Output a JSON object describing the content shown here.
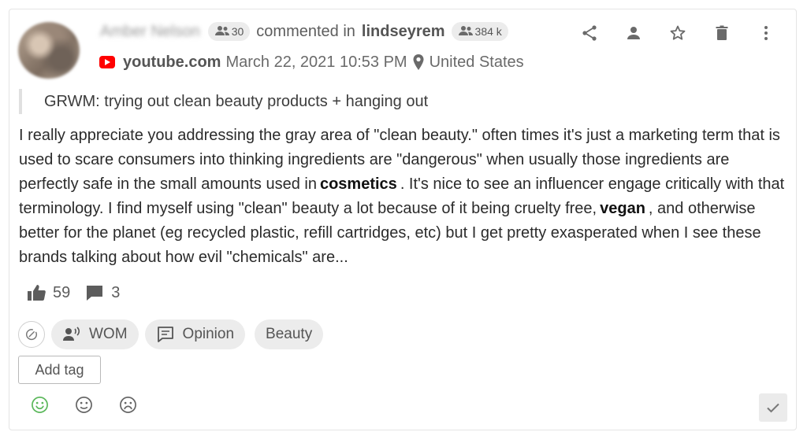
{
  "post": {
    "author_name": "Amber Nelson",
    "author_followers": "30",
    "action_text": "commented in",
    "channel_handle": "lindseyrem",
    "channel_followers": "384 k",
    "source_domain": "youtube.com",
    "date": "March 22, 2021 10:53 PM",
    "location": "United States",
    "quoted_title": "GRWM: trying out clean beauty products + hanging out",
    "body_segments": [
      "I really appreciate you addressing the gray area of \"clean beauty.\" often times it's just a marketing term that is used to scare consumers into thinking ingredients are \"dangerous\" when usually those ingredients are perfectly safe in the small amounts used in",
      "cosmetics",
      ". It's nice to see an influencer engage critically with that terminology. I find myself using \"clean\" beauty a lot because of it being cruelty free,",
      "vegan",
      ", and otherwise better for the planet (eg recycled plastic, refill cartridges, etc) but I get pretty exasperated when I see these brands talking about how evil \"chemicals\" are..."
    ]
  },
  "stats": {
    "likes": "59",
    "comments": "3"
  },
  "tags": {
    "wom": "WOM",
    "opinion": "Opinion",
    "beauty": "Beauty",
    "add_tag": "Add tag"
  },
  "icons": {
    "actions": [
      "share-icon",
      "person-icon",
      "star-icon",
      "trash-icon",
      "more-vert-icon"
    ],
    "sentiment": [
      "smile-icon",
      "neutral-face-icon",
      "frown-icon"
    ]
  },
  "colors": {
    "accent_positive": "#5cb85c",
    "youtube_red": "#ff0000",
    "pill_bg": "#ececec"
  }
}
